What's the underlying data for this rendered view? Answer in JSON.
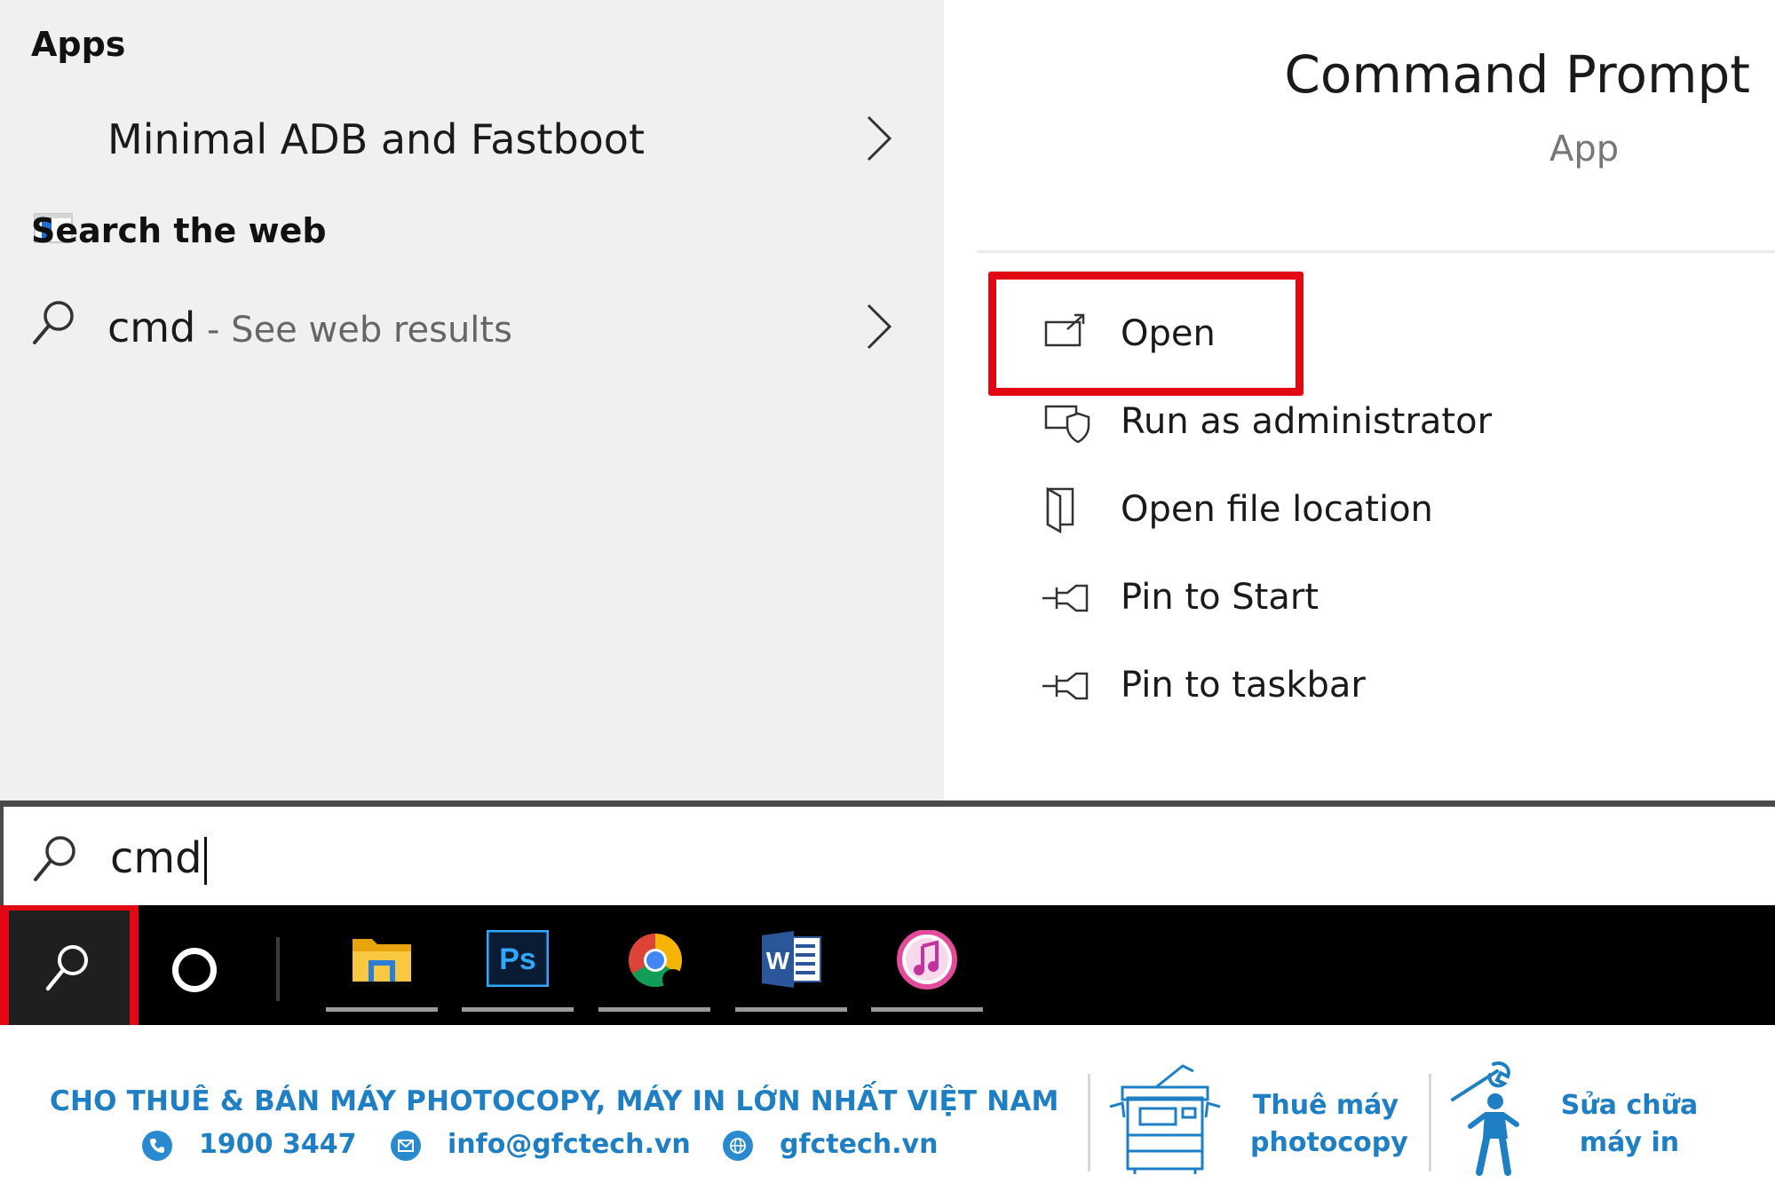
{
  "results": {
    "apps_heading": "Apps",
    "app_item": {
      "label": "Minimal ADB and Fastboot"
    },
    "web_heading": "Search the web",
    "web_item": {
      "query": "cmd",
      "suffix": " - See web results"
    }
  },
  "details": {
    "title": "Command Prompt",
    "type": "App",
    "actions": [
      {
        "label": "Open",
        "icon": "open-icon"
      },
      {
        "label": "Run as administrator",
        "icon": "admin-shield-icon"
      },
      {
        "label": "Open file location",
        "icon": "file-location-icon"
      },
      {
        "label": "Pin to Start",
        "icon": "pin-icon"
      },
      {
        "label": "Pin to taskbar",
        "icon": "pin-icon"
      }
    ]
  },
  "search": {
    "value": "cmd"
  },
  "taskbar": {
    "apps": [
      "file-explorer-icon",
      "photoshop-icon",
      "chrome-icon",
      "word-icon",
      "itunes-icon"
    ],
    "photoshop_text": "Ps",
    "word_text": "W"
  },
  "footer": {
    "headline": "CHO THUÊ & BÁN MÁY PHOTOCOPY, MÁY IN LỚN NHẤT VIỆT NAM",
    "phone": "1900 3447",
    "email": "info@gfctech.vn",
    "website": "gfctech.vn",
    "service1": {
      "line1": "Thuê máy",
      "line2": "photocopy"
    },
    "service2": {
      "line1": "Sửa chữa",
      "line2": "máy in"
    }
  },
  "colors": {
    "highlight": "#e30613",
    "brand_blue": "#1f7fc4"
  }
}
